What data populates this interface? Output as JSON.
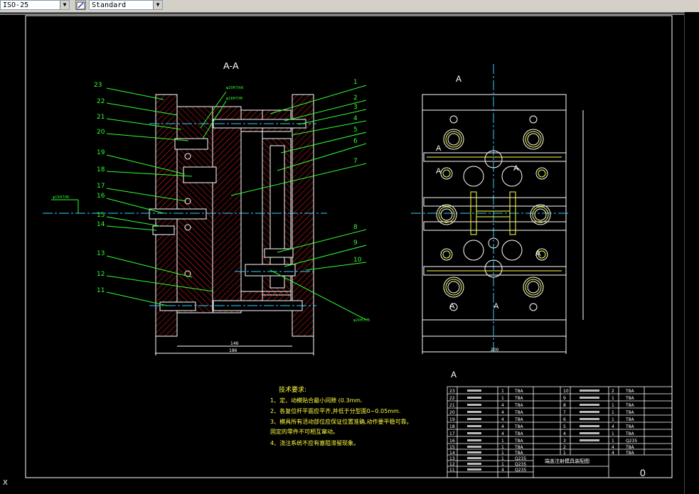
{
  "toolbar": {
    "dimstyle_value": "ISO-25",
    "textstyle_value": "Standard"
  },
  "drawing": {
    "section_title": "A-A",
    "section_marker": "A",
    "left_callouts": [
      "23",
      "22",
      "21",
      "20",
      "19",
      "18",
      "17",
      "16",
      "15",
      "14",
      "13",
      "12",
      "11"
    ],
    "right_callouts": [
      "1",
      "2",
      "3",
      "4",
      "5",
      "6",
      "7",
      "8",
      "9",
      "10"
    ],
    "fit_labels": [
      "φ20H7/k6",
      "φ16H7/f6",
      "φ15H7/f6",
      "φ20H7/f6"
    ],
    "dim_width_inner": "146",
    "dim_width_outer": "186",
    "dim_right_bottom": "200",
    "tech_title": "技术要求:",
    "tech_notes": [
      "1、定、动模贴合最小间隙 (0.3mm.",
      "2、各复位杆平面应平齐,并低于分型面0~0.05mm.",
      "3、模具所有活动部位应保证位置准确,动作要平稳可靠。",
      "   固定的零件不可相互窜动。",
      "4、浇注系统不应有塞阻滞留现象。"
    ],
    "bom_left_numbers": [
      "23",
      "22",
      "21",
      "20",
      "19",
      "18",
      "17",
      "16",
      "15",
      "14",
      "13",
      "12",
      "11"
    ],
    "bom_right_numbers": [
      "10",
      "9",
      "8",
      "7",
      "6",
      "5",
      "4",
      "3",
      "2",
      "1"
    ],
    "bom_qty_col": [
      "1",
      "1",
      "4",
      "4",
      "4",
      "4",
      "4",
      "1",
      "1",
      "1",
      "1",
      "1",
      "4"
    ],
    "bom_mat_col": [
      "T8A",
      "T8A",
      "T8A",
      "T8A",
      "T8A",
      "T8A",
      "T8A",
      "T8A",
      "T8A",
      "T8A",
      "Q235",
      "Q235",
      "Q235"
    ],
    "bom_right_qty": [
      "2",
      "1",
      "1",
      "1",
      "1",
      "4",
      "1",
      "1",
      "4",
      "4"
    ],
    "bom_right_mat": [
      "T8A",
      "T8A",
      "T8A",
      "T8A",
      "T8A",
      "T8A",
      "T8A",
      "Q235",
      "T8A",
      "T8A"
    ],
    "title_block_name": "端盖注射模具装配图",
    "title_block_zero": "0",
    "axis_x": "X"
  }
}
